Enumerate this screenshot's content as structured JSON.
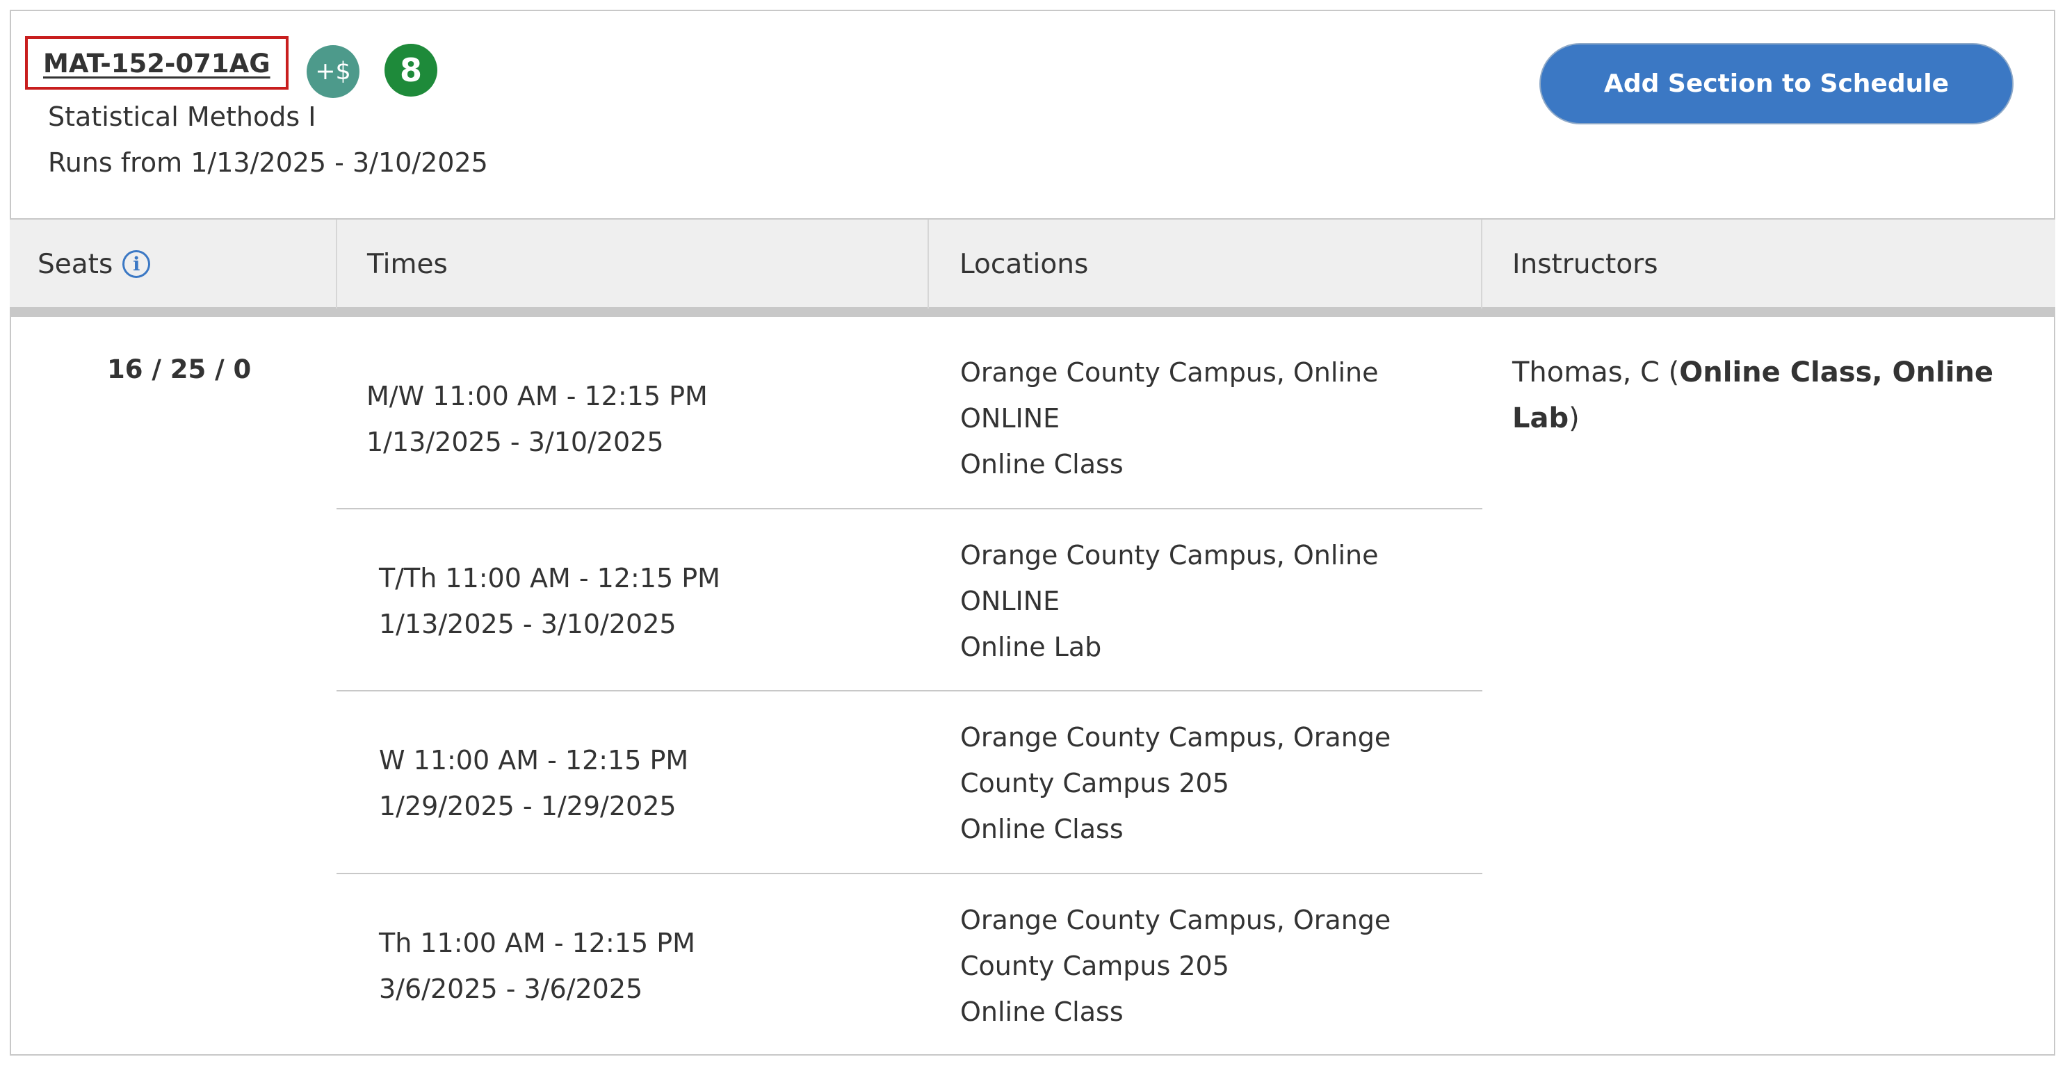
{
  "course": {
    "code": "MAT-152-071AG",
    "fee_icon_text": "+$",
    "badge_count": "8",
    "title": "Statistical Methods I",
    "runs": "Runs from 1/13/2025 - 3/10/2025"
  },
  "actions": {
    "add_section_label": "Add Section to Schedule"
  },
  "table": {
    "headers": {
      "seats": "Seats",
      "times": "Times",
      "locations": "Locations",
      "instructors": "Instructors"
    },
    "seats_value": "16 / 25 / 0",
    "meetings": [
      {
        "time": "M/W 11:00 AM - 12:15 PM",
        "dates": "1/13/2025 - 3/10/2025",
        "loc_line1": "Orange County Campus, Online",
        "loc_line2": "ONLINE",
        "loc_line3": "Online Class"
      },
      {
        "time": "T/Th 11:00 AM - 12:15 PM",
        "dates": "1/13/2025 - 3/10/2025",
        "loc_line1": "Orange County Campus, Online",
        "loc_line2": "ONLINE",
        "loc_line3": "Online Lab"
      },
      {
        "time": "W 11:00 AM - 12:15 PM",
        "dates": "1/29/2025 - 1/29/2025",
        "loc_line1": "Orange County Campus, Orange",
        "loc_line2": "County Campus 205",
        "loc_line3": "Online Class"
      },
      {
        "time": "Th 11:00 AM - 12:15 PM",
        "dates": "3/6/2025 - 3/6/2025",
        "loc_line1": "Orange County Campus, Orange",
        "loc_line2": "County Campus 205",
        "loc_line3": "Online Class"
      }
    ],
    "instructor": {
      "name_prefix": "Thomas, C (",
      "roles_bold": "Online Class, Online Lab",
      "suffix": ")"
    }
  },
  "colors": {
    "highlight_border": "#c81e1e",
    "primary_button": "#3b78c4",
    "fee_icon": "#4d9a8b",
    "badge": "#1e8a3a",
    "header_bg": "#efefef"
  },
  "icons": {
    "fee": "fee-plus-dollar-icon",
    "info": "info-icon"
  }
}
